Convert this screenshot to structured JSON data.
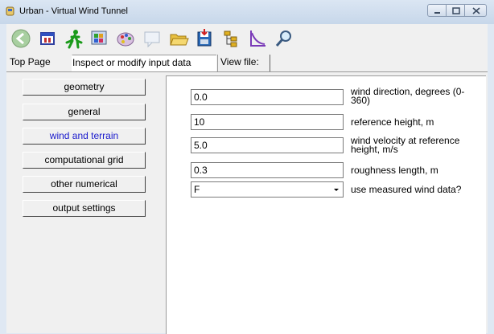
{
  "window": {
    "title": "Urban - Virtual Wind Tunnel"
  },
  "toolbar": {
    "icons": [
      "back-icon",
      "grid-icon",
      "run-icon",
      "palette-icon",
      "paint-icon",
      "comment-icon",
      "open-folder-icon",
      "save-icon",
      "tree-icon",
      "chart-icon",
      "search-icon"
    ]
  },
  "tabs": {
    "top_page": "Top Page",
    "inspect": "Inspect or modify input data",
    "view_file": "View file:"
  },
  "nav": {
    "geometry": "geometry",
    "general": "general",
    "wind_terrain": "wind and terrain",
    "comp_grid": "computational grid",
    "other_numerical": "other numerical",
    "output_settings": "output settings"
  },
  "form": {
    "wind_direction": {
      "value": "0.0",
      "label": "wind direction, degrees (0-360)"
    },
    "reference_height": {
      "value": "10",
      "label": "reference height, m"
    },
    "wind_velocity": {
      "value": "5.0",
      "label": "wind velocity at reference height, m/s"
    },
    "roughness_length": {
      "value": "0.3",
      "label": "roughness length, m"
    },
    "measured_wind": {
      "value": "F",
      "label": "use measured wind data?"
    }
  },
  "colors": {
    "active_nav": "#1a1acc",
    "titlebar": "#c7d7ea"
  }
}
